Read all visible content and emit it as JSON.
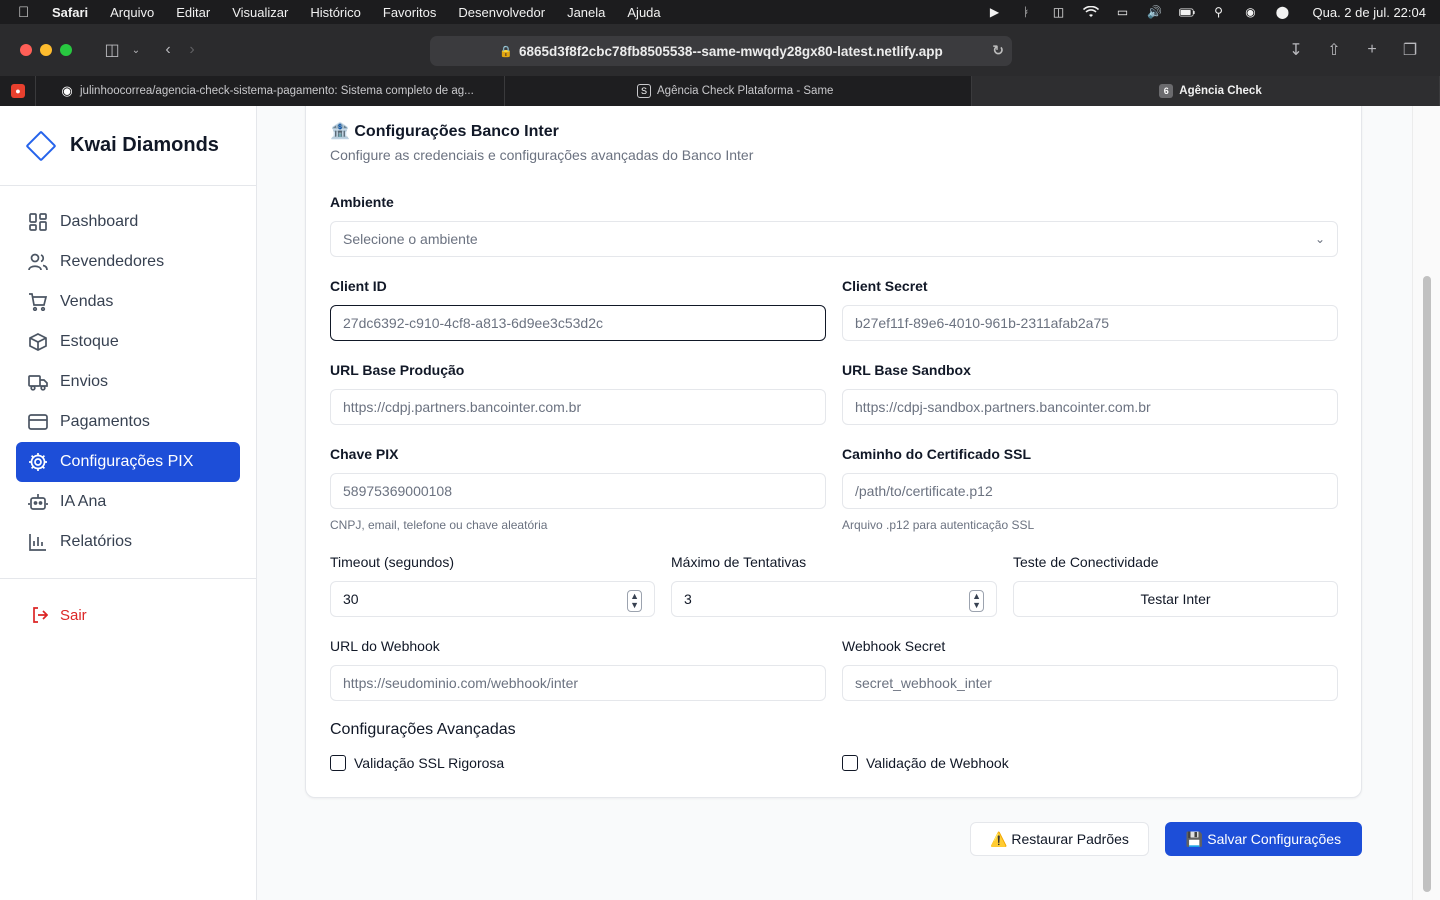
{
  "menubar": {
    "app": "Safari",
    "items": [
      "Arquivo",
      "Editar",
      "Visualizar",
      "Histórico",
      "Favoritos",
      "Desenvolvedor",
      "Janela",
      "Ajuda"
    ],
    "clock": "Qua. 2 de jul.  22:04"
  },
  "browser": {
    "url": "6865d3f8f2cbc78fb8505538--same-mwqdy28gx80-latest.netlify.app",
    "tabs": [
      {
        "title": "julinhoocorrea/agencia-check-sistema-pagamento: Sistema completo de ag..."
      },
      {
        "title": "Agência Check Plataforma - Same"
      },
      {
        "title": "Agência Check",
        "badge": "6"
      }
    ]
  },
  "sidebar": {
    "brand": "Kwai Diamonds",
    "items": [
      {
        "label": "Dashboard",
        "icon": "dashboard-icon"
      },
      {
        "label": "Revendedores",
        "icon": "users-icon"
      },
      {
        "label": "Vendas",
        "icon": "cart-icon"
      },
      {
        "label": "Estoque",
        "icon": "box-icon"
      },
      {
        "label": "Envios",
        "icon": "truck-icon"
      },
      {
        "label": "Pagamentos",
        "icon": "card-icon"
      },
      {
        "label": "Configurações PIX",
        "icon": "gear-icon"
      },
      {
        "label": "IA Ana",
        "icon": "bot-icon"
      },
      {
        "label": "Relatórios",
        "icon": "chart-icon"
      }
    ],
    "logout": "Sair"
  },
  "form": {
    "title": "🏦 Configurações Banco Inter",
    "description": "Configure as credenciais e configurações avançadas do Banco Inter",
    "ambiente_label": "Ambiente",
    "ambiente_placeholder": "Selecione o ambiente",
    "client_id_label": "Client ID",
    "client_id_placeholder": "27dc6392-c910-4cf8-a813-6d9ee3c53d2c",
    "client_secret_label": "Client Secret",
    "client_secret_placeholder": "b27ef11f-89e6-4010-961b-2311afab2a75",
    "url_prod_label": "URL Base Produção",
    "url_prod_placeholder": "https://cdpj.partners.bancointer.com.br",
    "url_sandbox_label": "URL Base Sandbox",
    "url_sandbox_placeholder": "https://cdpj-sandbox.partners.bancointer.com.br",
    "pix_label": "Chave PIX",
    "pix_placeholder": "58975369000108",
    "pix_hint": "CNPJ, email, telefone ou chave aleatória",
    "cert_label": "Caminho do Certificado SSL",
    "cert_placeholder": "/path/to/certificate.p12",
    "cert_hint": "Arquivo .p12 para autenticação SSL",
    "timeout_label": "Timeout (segundos)",
    "timeout_value": "30",
    "retries_label": "Máximo de Tentativas",
    "retries_value": "3",
    "test_label": "Teste de Conectividade",
    "test_button": "Testar Inter",
    "webhook_url_label": "URL do Webhook",
    "webhook_url_placeholder": "https://seudominio.com/webhook/inter",
    "webhook_secret_label": "Webhook Secret",
    "webhook_secret_placeholder": "secret_webhook_inter",
    "advanced_title": "Configurações Avançadas",
    "ssl_check": "Validação SSL Rigorosa",
    "webhook_check": "Validação de Webhook"
  },
  "actions": {
    "restore": "⚠️ Restaurar Padrões",
    "save": "💾 Salvar Configurações"
  },
  "colors": {
    "accent": "#1d4ed8",
    "danger": "#dc2626"
  }
}
